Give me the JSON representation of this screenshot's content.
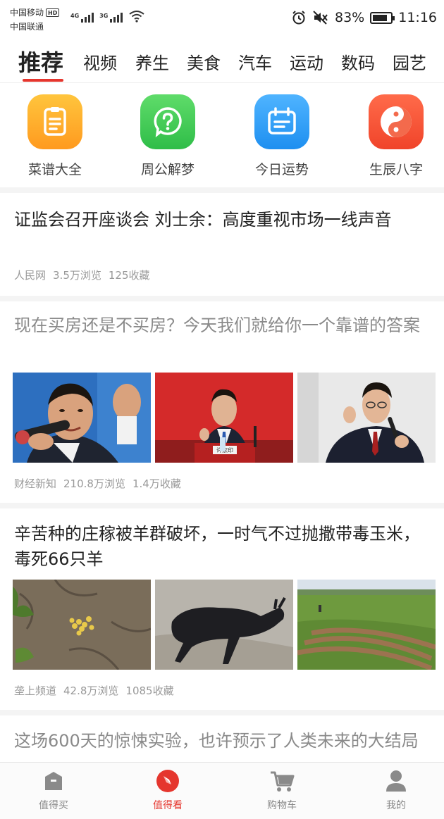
{
  "status_bar": {
    "carrier_1": "中国移动",
    "carrier_1_badge": "HD",
    "carrier_2": "中国联通",
    "network_1": "4G",
    "network_2": "3G",
    "battery": "83%",
    "battery_level": 0.83,
    "time": "11:16"
  },
  "tabs": [
    {
      "label": "推荐",
      "active": true
    },
    {
      "label": "视频"
    },
    {
      "label": "养生"
    },
    {
      "label": "美食"
    },
    {
      "label": "汽车"
    },
    {
      "label": "运动"
    },
    {
      "label": "数码"
    },
    {
      "label": "园艺"
    }
  ],
  "shortcuts": [
    {
      "label": "菜谱大全",
      "icon": "recipe-list-icon",
      "color": "#ffb02e"
    },
    {
      "label": "周公解梦",
      "icon": "question-bubble-icon",
      "color": "#3fc553"
    },
    {
      "label": "今日运势",
      "icon": "calendar-icon",
      "color": "#2a9af4"
    },
    {
      "label": "生辰八字",
      "icon": "yin-yang-icon",
      "color": "#f4532f"
    }
  ],
  "articles": [
    {
      "title": "证监会召开座谈会 刘士余：高度重视市场一线声音",
      "source": "人民网",
      "views": "3.5万浏览",
      "favorites": "125收藏"
    },
    {
      "title": "现在买房还是不买房？今天我们就给你一个靠谱的答案",
      "source": "财经新知",
      "views": "210.8万浏览",
      "favorites": "1.4万收藏",
      "read": true
    },
    {
      "title": "辛苦种的庄稼被羊群破坏，一时气不过抛撒带毒玉米，毒死66只羊",
      "source": "垄上频道",
      "views": "42.8万浏览",
      "favorites": "1085收藏"
    },
    {
      "title": "这场600天的惊悚实验，也许预示了人类未来的大结局",
      "read": true
    }
  ],
  "photo_sign": "许家印",
  "bottom_nav": [
    {
      "label": "值得买",
      "icon": "shop-icon"
    },
    {
      "label": "值得看",
      "icon": "compass-icon",
      "active": true
    },
    {
      "label": "购物车",
      "icon": "cart-icon"
    },
    {
      "label": "我的",
      "icon": "user-icon"
    }
  ],
  "colors": {
    "accent": "#e5362e",
    "text": "#222222",
    "meta": "#999999"
  }
}
